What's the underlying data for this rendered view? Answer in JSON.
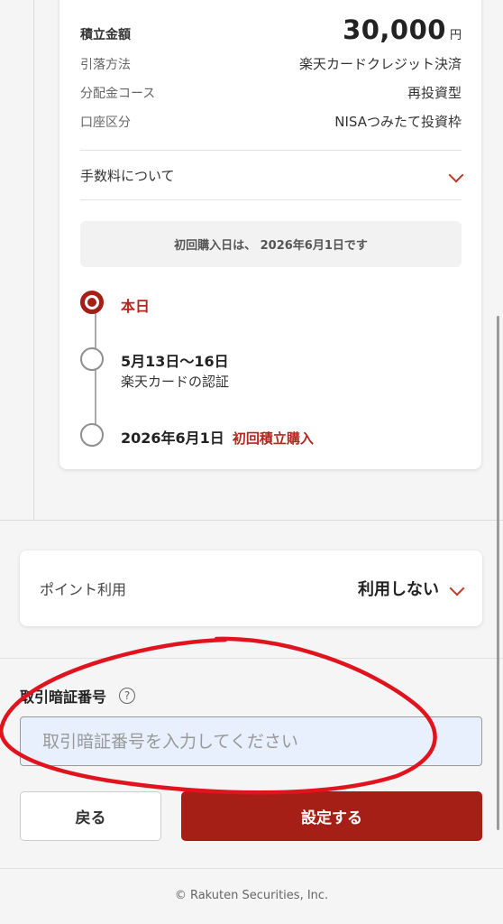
{
  "summary": {
    "amount_label": "積立金額",
    "amount_value": "30,000",
    "amount_unit": "円",
    "rows": [
      {
        "label": "引落方法",
        "value": "楽天カードクレジット決済"
      },
      {
        "label": "分配金コース",
        "value": "再投資型"
      },
      {
        "label": "口座区分",
        "value": "NISAつみたて投資枠"
      }
    ],
    "fee_label": "手数料について",
    "first_purchase_notice": "初回購入日は、 2026年6月1日です"
  },
  "timeline": {
    "step1": "本日",
    "step2_date": "5月13日〜16日",
    "step2_desc": "楽天カードの認証",
    "step3_date": "2026年6月1日",
    "step3_desc": "初回積立購入"
  },
  "points": {
    "label": "ポイント利用",
    "value": "利用しない"
  },
  "pin": {
    "label": "取引暗証番号",
    "help_glyph": "?",
    "placeholder": "取引暗証番号を入力してください"
  },
  "buttons": {
    "back": "戻る",
    "submit": "設定する"
  },
  "footer": "© Rakuten Securities, Inc.",
  "colors": {
    "accent": "#a51f17",
    "annotation": "#e0141e"
  }
}
